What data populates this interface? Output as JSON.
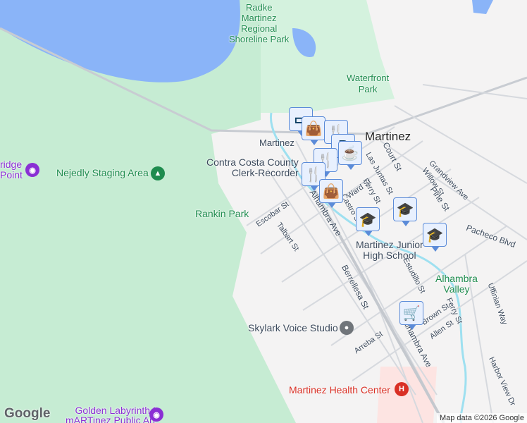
{
  "labels": {
    "shoreline": "Radke\nMartinez\nRegional\nShoreline Park",
    "waterfront": "Waterfront\nPark",
    "martinez_city": "Martinez",
    "martinez_station": "Martinez",
    "clerk": "Contra Costa County\nClerk-Recorder",
    "nejedly": "Nejedly Staging Area",
    "ridge_point": "ridge\nPoint",
    "rankin": "Rankin Park",
    "jr_high": "Martinez Junior\nHigh School",
    "alhambra_valley": "Alhambra\nValley",
    "skylark": "Skylark Voice Studio",
    "health": "Martinez Health Center",
    "labyrinth": "Golden Labyrinth |\nmARTinez Public Art"
  },
  "streets": {
    "escobar": "Escobar St",
    "talbart": "Talbart St",
    "alhambra": "Alhambra Ave",
    "alhambra2": "Alhambra Ave",
    "court": "Court St",
    "juntas": "Las Juntas St",
    "ferry": "Ferry St",
    "ward": "Ward St",
    "castro": "Castro St",
    "grandview": "Grandview Ave",
    "willow": "Willow St",
    "pine": "Pine St",
    "pacheco": "Pacheco Blvd",
    "estudillo": "Estudillo St",
    "uffinian": "Uffinian Way",
    "berrellesa": "Berrellesa St",
    "brown": "Brown St",
    "allen": "Allen St",
    "ferry2": "Ferry St",
    "arreba": "Arreba St",
    "harbor": "Harbor View Dr"
  },
  "footer": {
    "logo": "Google",
    "attribution": "Map data ©2026 Google"
  },
  "markers": {
    "parking": "P"
  }
}
